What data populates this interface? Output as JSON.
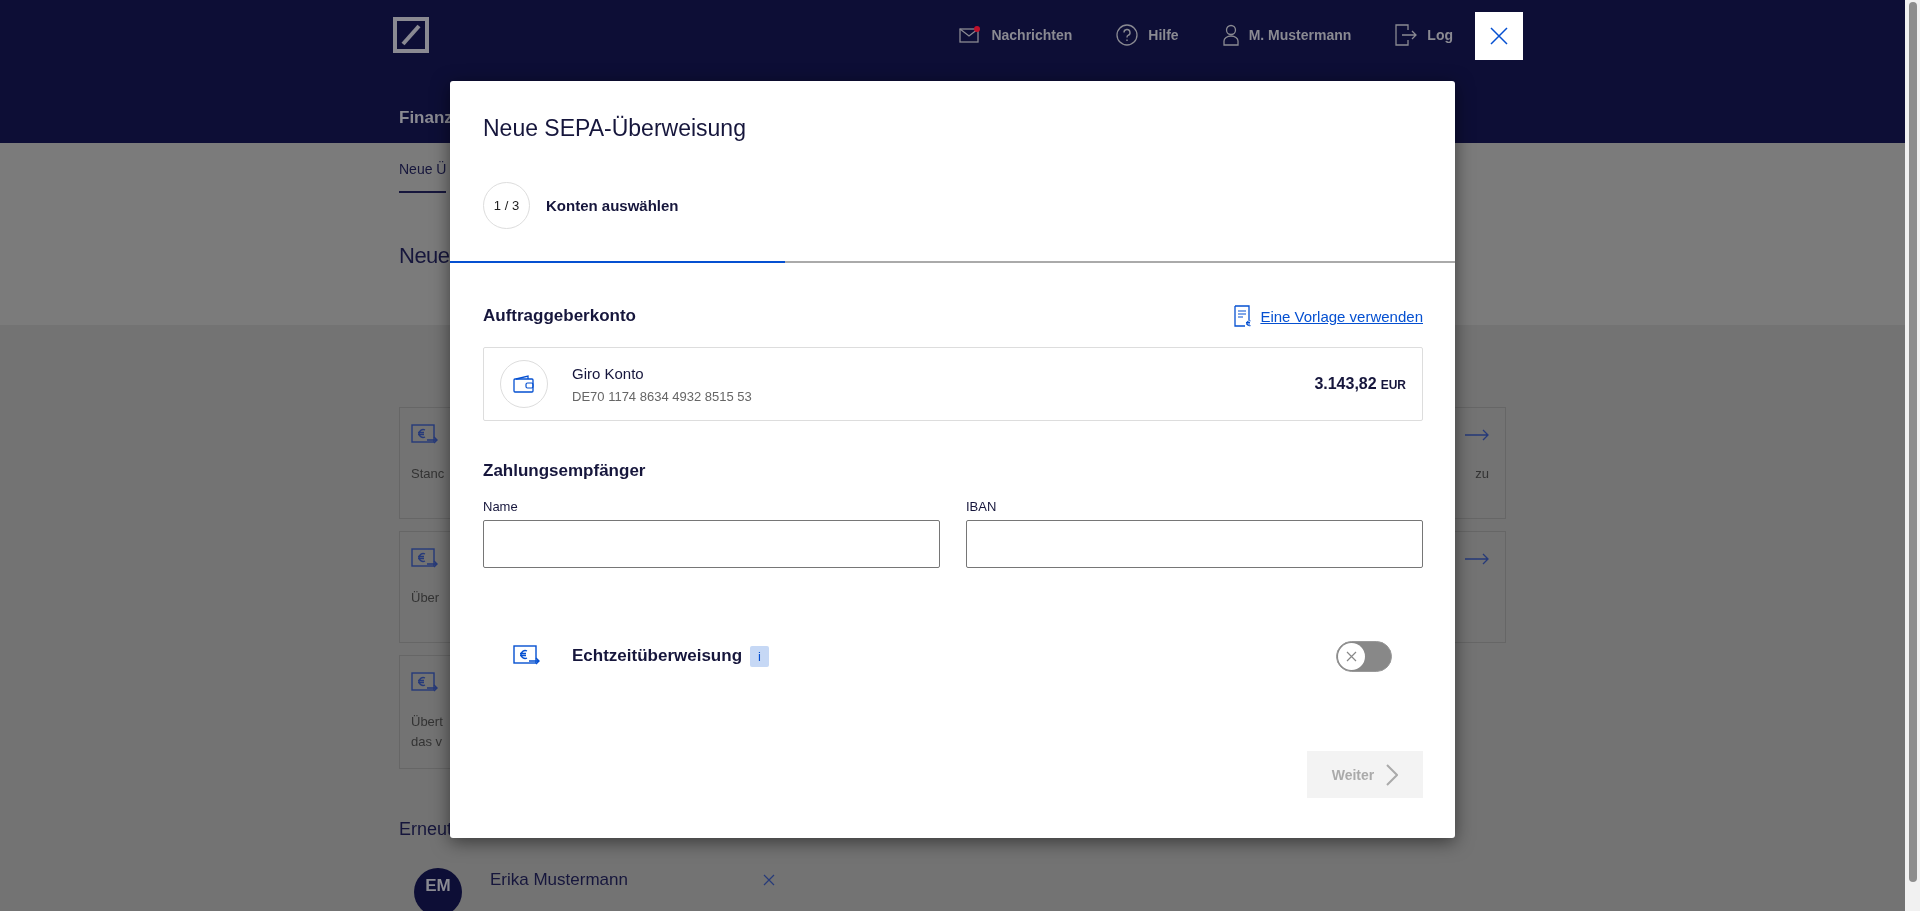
{
  "header": {
    "nav": [
      {
        "kind": "messages",
        "label": "Nachrichten",
        "unread": true
      },
      {
        "kind": "help",
        "label": "Hilfe"
      },
      {
        "kind": "user",
        "label": "M. Mustermann"
      },
      {
        "kind": "logout",
        "label": "Log"
      }
    ],
    "menu_label": "Finanz"
  },
  "subnav": {
    "tabs": [
      {
        "label": "Neue Ü",
        "selected": true
      }
    ]
  },
  "page_title": "Neue",
  "cards": [
    {
      "lines": [
        "Stanc"
      ],
      "trailing": "zu",
      "arrow": true
    },
    {
      "lines": [
        "Über"
      ],
      "arrow": true
    },
    {
      "lines": [
        "Übert",
        "das v"
      ]
    }
  ],
  "recent": {
    "title": "Erneut",
    "items": [
      {
        "initials": "EM",
        "name": "Erika Mustermann"
      }
    ]
  },
  "modal": {
    "title": "Neue SEPA-Überweisung",
    "step": {
      "counter": "1 / 3",
      "label": "Konten auswählen",
      "level": 0.333
    },
    "payer": {
      "title": "Auftraggeberkonto",
      "template_link": "Eine Vorlage verwenden",
      "account": {
        "name": "Giro Konto",
        "iban": "DE70 1174 8634 4932 8515 53",
        "amount": "3.143,82",
        "currency": "EUR"
      }
    },
    "payee": {
      "title": "Zahlungsempfänger",
      "fields": [
        {
          "label": "Name"
        },
        {
          "label": "IBAN"
        }
      ]
    },
    "instant": {
      "label": "Echtzeitüberweisung",
      "info": "i",
      "on": false
    },
    "next": {
      "label": "Weiter",
      "disabled": true
    }
  }
}
